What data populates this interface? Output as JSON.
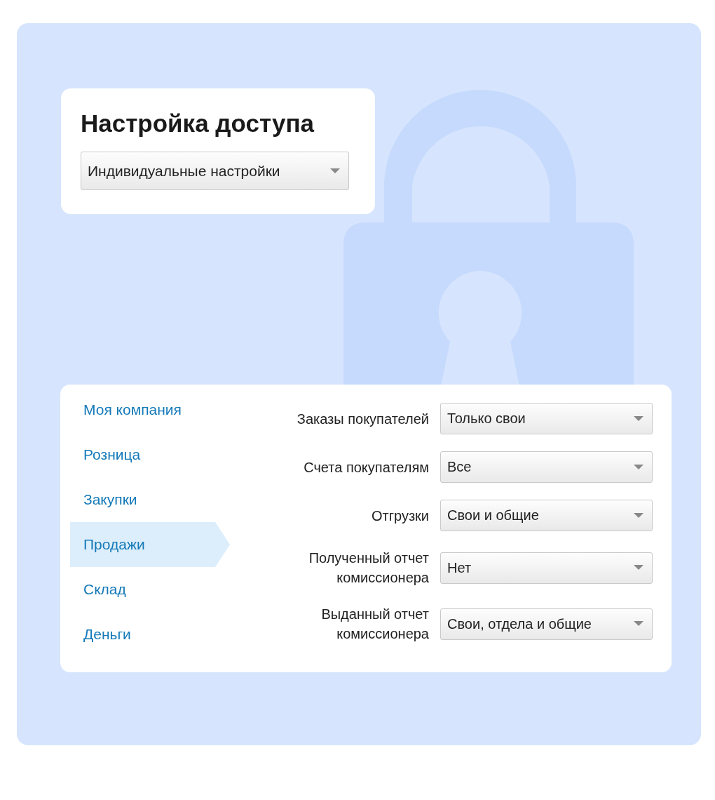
{
  "title": "Настройка доступа",
  "access_mode": {
    "value": "Индивидуальные настройки"
  },
  "sections": [
    {
      "label": "Моя компания",
      "selected": false
    },
    {
      "label": "Розница",
      "selected": false
    },
    {
      "label": "Закупки",
      "selected": false
    },
    {
      "label": "Продажи",
      "selected": true
    },
    {
      "label": "Склад",
      "selected": false
    },
    {
      "label": "Деньги",
      "selected": false
    }
  ],
  "permissions": [
    {
      "label": "Заказы покупателей",
      "value": "Только свои"
    },
    {
      "label": "Счета покупателям",
      "value": "Все"
    },
    {
      "label": "Отгрузки",
      "value": "Свои и общие"
    },
    {
      "label": "Полученный отчет комиссионера",
      "value": "Нет"
    },
    {
      "label": "Выданный отчет комиссионера",
      "value": "Свои, отдела и общие"
    }
  ]
}
